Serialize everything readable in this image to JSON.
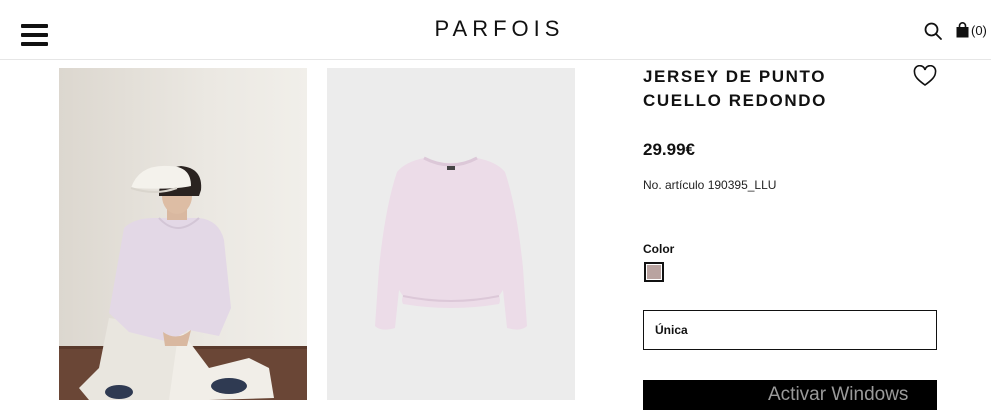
{
  "header": {
    "logo": "PARFOIS",
    "cart_count": "(0)",
    "icons": [
      "hamburger-menu-icon",
      "search-icon",
      "shopping-bag-icon"
    ]
  },
  "gallery": {
    "images": [
      "model-wearing-pink-sweater-photo",
      "pink-sweater-product-photo"
    ]
  },
  "product": {
    "title": "JERSEY DE PUNTO CUELLO REDONDO",
    "price": "29.99€",
    "sku": "No. artículo 190395_LLU",
    "color_label": "Color",
    "swatch_color": "#b9a3a0",
    "size_value": "Única"
  },
  "overlay": {
    "watermark": "Activar Windows"
  }
}
